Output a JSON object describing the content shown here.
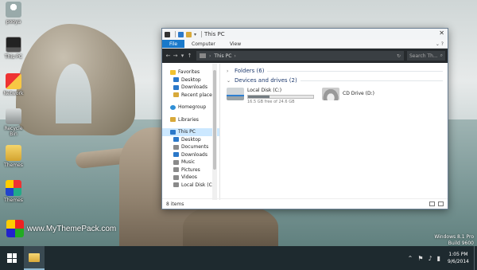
{
  "desktop": {
    "icons": [
      {
        "label": "pooya",
        "icon": "user-icon"
      },
      {
        "label": "This PC",
        "icon": "computer-icon"
      },
      {
        "label": "Network",
        "icon": "network-icon"
      },
      {
        "label": "Recycle Bin",
        "icon": "recycle-bin-icon"
      },
      {
        "label": "Themes",
        "icon": "folder-icon"
      },
      {
        "label": "Themes",
        "icon": "theme-pack-icon"
      }
    ],
    "brand": "www.MyThemePack.com",
    "watermark": {
      "line1": "Windows 8.1 Pro",
      "line2": "Build 9600"
    }
  },
  "taskbar": {
    "clock_time": "1:05 PM",
    "clock_date": "9/6/2014",
    "tray_icons": [
      "up-arrow-icon",
      "flag-icon",
      "volume-icon",
      "network-icon"
    ]
  },
  "window": {
    "title": "This PC",
    "close": "✕",
    "ribbon_tabs": [
      "File",
      "Computer",
      "View"
    ],
    "expand": "⌄ ?",
    "address": "This PC",
    "address_arrow": "›",
    "search_placeholder": "Search Th...",
    "nav_items": [
      {
        "label": "Favorites",
        "group": true,
        "icon": "star-icon",
        "color": "#f2c230"
      },
      {
        "label": "Desktop",
        "icon": "desktop-icon",
        "color": "#2b78c9"
      },
      {
        "label": "Downloads",
        "icon": "downloads-icon",
        "color": "#2b78c9"
      },
      {
        "label": "Recent places",
        "icon": "recent-places-icon",
        "color": "#d8a93a"
      },
      {
        "label": "Homegroup",
        "group": true,
        "icon": "homegroup-icon",
        "color": "#2f8fd6"
      },
      {
        "label": "Libraries",
        "group": true,
        "icon": "libraries-icon",
        "color": "#d8a93a"
      },
      {
        "label": "This PC",
        "group": true,
        "icon": "computer-icon",
        "color": "#2b78c9",
        "selected": true
      },
      {
        "label": "Desktop",
        "icon": "desktop-icon",
        "color": "#2b78c9"
      },
      {
        "label": "Documents",
        "icon": "documents-icon",
        "color": "#8a8a8a"
      },
      {
        "label": "Downloads",
        "icon": "downloads-icon",
        "color": "#2b78c9"
      },
      {
        "label": "Music",
        "icon": "music-icon",
        "color": "#8a8a8a"
      },
      {
        "label": "Pictures",
        "icon": "pictures-icon",
        "color": "#8a8a8a"
      },
      {
        "label": "Videos",
        "icon": "videos-icon",
        "color": "#8a8a8a"
      },
      {
        "label": "Local Disk (C:)",
        "icon": "drive-icon",
        "color": "#8a8a8a"
      }
    ],
    "folders_header": "Folders (6)",
    "devices_header": "Devices and drives (2)",
    "drives": [
      {
        "name": "Local Disk (C:)",
        "free": "16.5 GB free of 24.6 GB",
        "used_fraction": 0.33,
        "icon": "hard-disk-icon"
      },
      {
        "name": "CD Drive (D:)",
        "icon": "cd-drive-icon"
      }
    ],
    "status": "8 items"
  }
}
